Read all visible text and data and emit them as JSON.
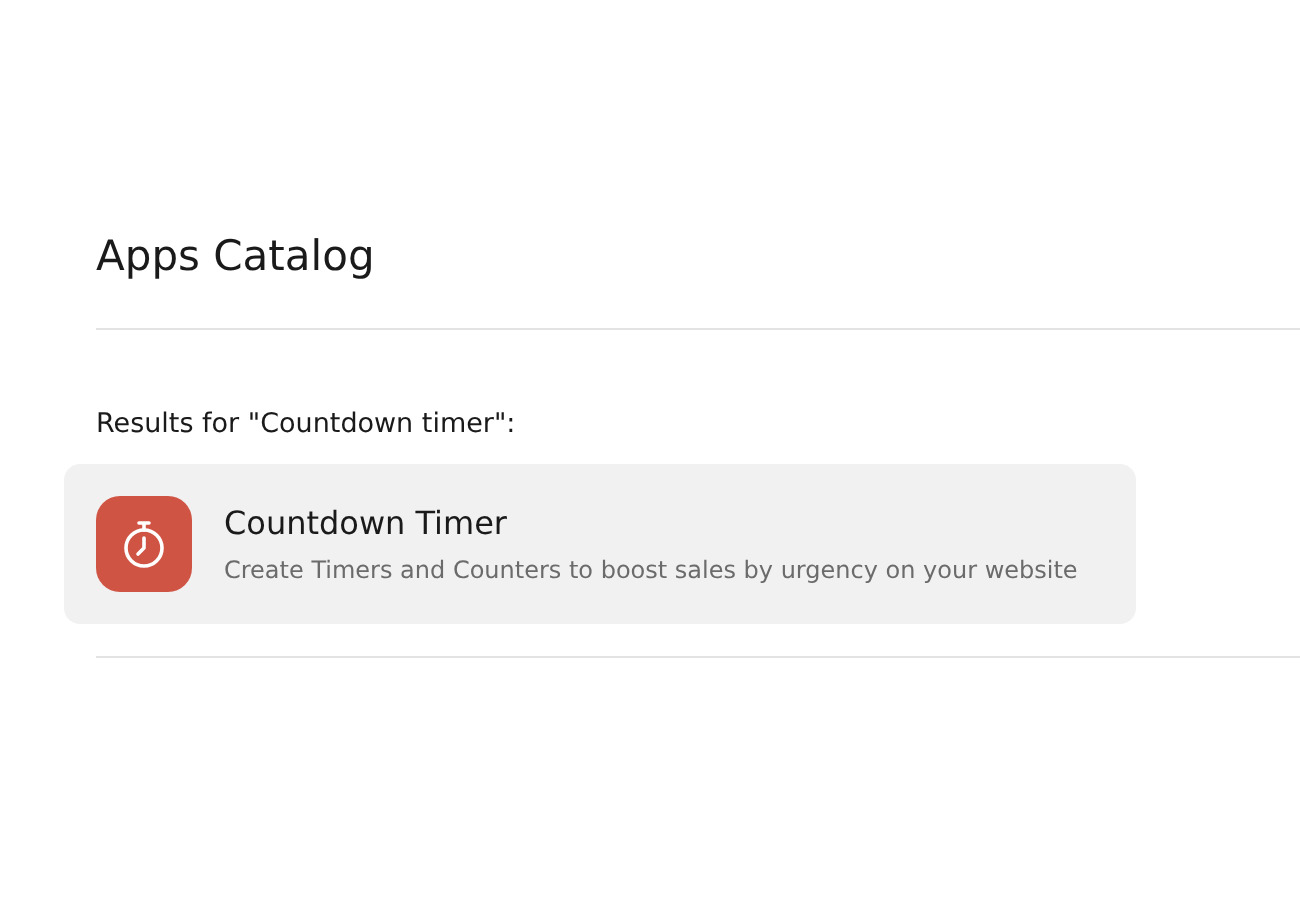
{
  "title": "Apps Catalog",
  "results_label": "Results for \"Countdown timer\":",
  "results": [
    {
      "name": "Countdown Timer",
      "description": "Create Timers and Counters to boost sales by urgency on your website",
      "color": "#d05444"
    }
  ]
}
